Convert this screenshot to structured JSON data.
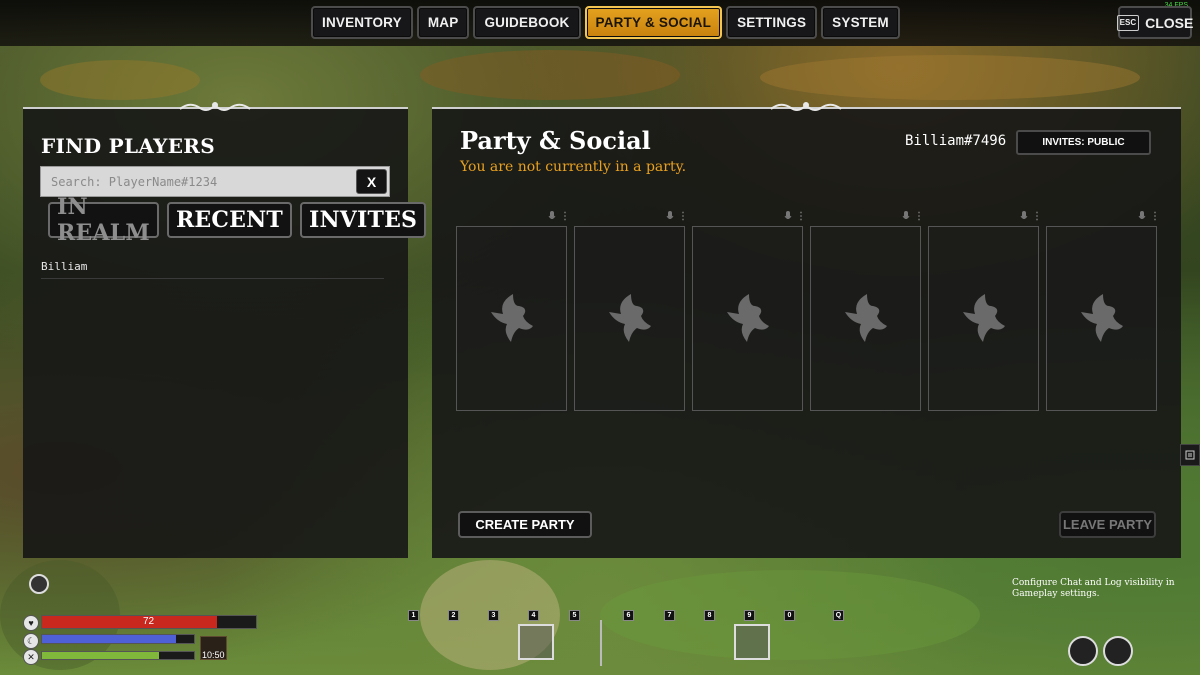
{
  "topbar": {
    "tabs": [
      {
        "label": "INVENTORY",
        "active": false
      },
      {
        "label": "MAP",
        "active": false
      },
      {
        "label": "GUIDEBOOK",
        "active": false
      },
      {
        "label": "PARTY & SOCIAL",
        "active": true
      },
      {
        "label": "SETTINGS",
        "active": false
      },
      {
        "label": "SYSTEM",
        "active": false
      }
    ],
    "close": {
      "key": "ESC",
      "label": "CLOSE"
    },
    "fps": "34 FPS"
  },
  "find_players": {
    "title": "FIND PLAYERS",
    "search_placeholder": "Search: PlayerName#1234",
    "clear_label": "X",
    "tabs": [
      {
        "label": "IN REALM",
        "active": false
      },
      {
        "label": "RECENT",
        "active": true
      },
      {
        "label": "INVITES",
        "active": true
      }
    ],
    "players": [
      "Billiam"
    ]
  },
  "party": {
    "title": "Party & Social",
    "status": "You are not currently in a party.",
    "player_tag": "Billiam#7496",
    "invites_label": "INVITES: PUBLIC",
    "slot_count": 6,
    "create_label": "CREATE PARTY",
    "leave_label": "LEAVE PARTY"
  },
  "hud": {
    "health": 72,
    "health_max": 100,
    "health_fill": 0.82,
    "mana_fill": 0.88,
    "stamina_fill": 0.77,
    "time": "10:50",
    "colors": {
      "health": "#c8281e",
      "mana": "#4f5fd6",
      "stamina": "#7fb83a",
      "accent": "#e4a21f"
    },
    "hotbar_keys": [
      "1",
      "2",
      "3",
      "4",
      "5",
      "6",
      "7",
      "8",
      "9",
      "0",
      "Q"
    ],
    "selected_slots": [
      "4",
      "9"
    ]
  },
  "tip": "Configure Chat and Log visibility in Gameplay settings."
}
